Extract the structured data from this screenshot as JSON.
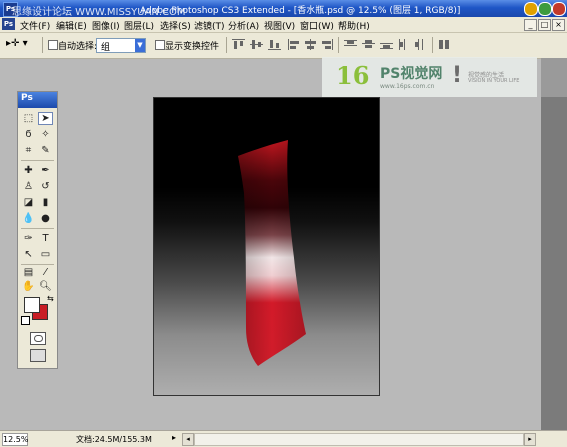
{
  "titlebar": {
    "watermark": "思缘设计论坛 WWW.MISSYUAN.COM",
    "title": "Adobe Photoshop CS3 Extended - [香水瓶.psd @ 12.5% (图层 1, RGB/8)]"
  },
  "menu": {
    "items": [
      "文件(F)",
      "编辑(E)",
      "图像(I)",
      "图层(L)",
      "选择(S)",
      "滤镜(T)",
      "分析(A)",
      "视图(V)",
      "窗口(W)",
      "帮助(H)"
    ]
  },
  "options": {
    "auto_select_label": "自动选择:",
    "auto_select_value": "组",
    "show_transform_label": "显示变换控件"
  },
  "logo": {
    "number": "16",
    "brand": "PS视觉网",
    "url": "www.16ps.com.cn",
    "slogan_cn": "视觉感的生活",
    "slogan_en": "VISION IN YOUR LIFE"
  },
  "toolbox": {
    "badge": "Ps",
    "foreground_color": "#ffffff",
    "background_color": "#c81d25"
  },
  "canvas": {
    "background": "black-to-gray gradient",
    "shape_color": "#d11d2a"
  },
  "status": {
    "zoom": "12.5%",
    "doc_size": "文档:24.5M/155.3M"
  }
}
